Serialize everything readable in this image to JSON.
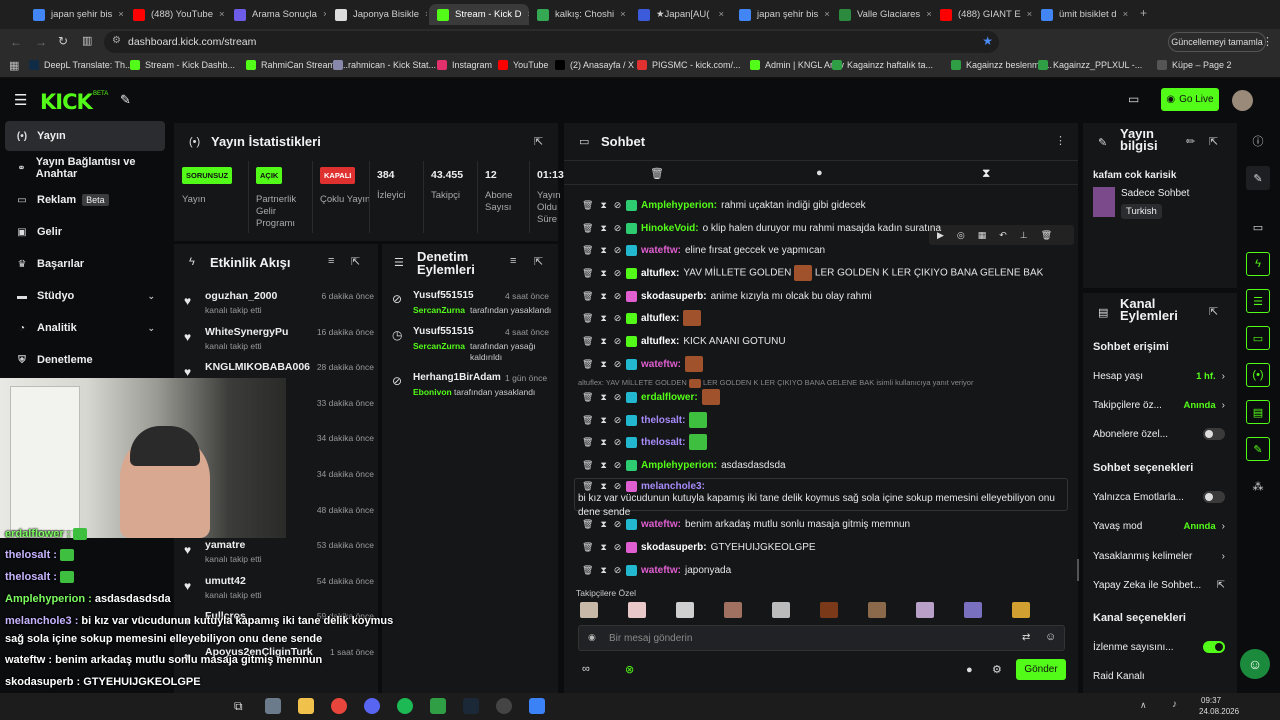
{
  "browser": {
    "tabs": [
      {
        "label": "japan şehir bis",
        "color": "#4285f4"
      },
      {
        "label": "(488) YouTube",
        "color": "#ff0000"
      },
      {
        "label": "Arama Sonuçla",
        "color": "#6c5ce7"
      },
      {
        "label": "Japonya Bisikle",
        "color": "#ddd"
      },
      {
        "label": "Stream - Kick D",
        "color": "#53fc18"
      },
      {
        "label": "kalkış: Choshi",
        "color": "#34a853"
      },
      {
        "label": "★Japan[AU(",
        "color": "#3b5bdb"
      },
      {
        "label": "japan şehir bis",
        "color": "#4285f4"
      },
      {
        "label": "Valle Glaciares",
        "color": "#2b8a3e"
      },
      {
        "label": "(488) GIANT E",
        "color": "#ff0000"
      },
      {
        "label": "ümit bisiklet d",
        "color": "#4285f4"
      }
    ],
    "url": "dashboard.kick.com/stream",
    "update_label": "Güncellemeyi tamamla",
    "bookmarks": [
      {
        "label": "DeepL Translate: Th...",
        "color": "#0f2b46"
      },
      {
        "label": "Stream - Kick Dashb...",
        "color": "#53fc18"
      },
      {
        "label": "RahmiCan Stream -...",
        "color": "#53fc18"
      },
      {
        "label": "rahmican - Kick Stat...",
        "color": "#8888aa"
      },
      {
        "label": "Instagram",
        "color": "#e1306c"
      },
      {
        "label": "YouTube",
        "color": "#ff0000"
      },
      {
        "label": "(2) Anasayfa / X",
        "color": "#000000"
      },
      {
        "label": "PIGSMC - kick.com/...",
        "color": "#e03131"
      },
      {
        "label": "Admin | KNGL Arşiv",
        "color": "#53fc18"
      },
      {
        "label": "Kagainzz haftalık ta...",
        "color": "#2f9e44"
      },
      {
        "label": "Kagainzz beslenme...",
        "color": "#2f9e44"
      },
      {
        "label": "Kagainzz_PPLXUL -...",
        "color": "#2f9e44"
      },
      {
        "label": "Küpe – Page 2",
        "color": "#555555"
      }
    ]
  },
  "nav": {
    "logo": "KICK",
    "logo_sup": "BETA",
    "go_live": "Go Live"
  },
  "sidebar": [
    {
      "label": "Yayın",
      "icon": "broadcast-icon"
    },
    {
      "label": "Yayın Bağlantısı ve Anahtar",
      "icon": "link-icon"
    },
    {
      "label": "Reklam",
      "icon": "ad-icon",
      "badge": "Beta"
    },
    {
      "label": "Gelir",
      "icon": "wallet-icon"
    },
    {
      "label": "Başarılar",
      "icon": "trophy-icon"
    },
    {
      "label": "Stüdyo",
      "icon": "studio-icon"
    },
    {
      "label": "Analitik",
      "icon": "chart-icon"
    },
    {
      "label": "Denetleme",
      "icon": "shield-icon"
    }
  ],
  "stats": {
    "title": "Yayın İstatistikleri",
    "items": [
      {
        "badge": "SORUNSUZ",
        "label": "Yayın",
        "color": "#53fc18"
      },
      {
        "badge": "AÇIK",
        "label": "Partnerlik Gelir Programı",
        "color": "#53fc18"
      },
      {
        "badge": "KAPALI",
        "label": "Çoklu Yayın",
        "color": "#e03131"
      },
      {
        "value": "384",
        "label": "İzleyici"
      },
      {
        "value": "43.455",
        "label": "Takipçi"
      },
      {
        "value": "12",
        "label": "Abone Sayısı"
      },
      {
        "value": "01:13",
        "label": "Yayın Oldu Süre"
      }
    ]
  },
  "events": {
    "title": "Etkinlik Akışı",
    "items": [
      {
        "name": "oguzhan_2000",
        "sub": "kanalı takip etti",
        "time": "6 dakika önce"
      },
      {
        "name": "WhiteSynergyPu",
        "sub": "kanalı takip etti",
        "time": "16 dakika önce"
      },
      {
        "name": "KNGLMIKOBABA006",
        "sub": "",
        "time": "28 dakika önce"
      },
      {
        "name": "",
        "sub": "",
        "time": "33 dakika önce"
      },
      {
        "name": "",
        "sub": "",
        "time": "34 dakika önce"
      },
      {
        "name": "",
        "sub": "",
        "time": "34 dakika önce"
      },
      {
        "name": "",
        "sub": "",
        "time": "48 dakika önce"
      },
      {
        "name": "yamatre",
        "sub": "kanalı takip etti",
        "time": "53 dakika önce"
      },
      {
        "name": "umutt42",
        "sub": "kanalı takip etti",
        "time": "54 dakika önce"
      },
      {
        "name": "Fullcros",
        "sub": "",
        "time": "59 dakika önce"
      },
      {
        "name": "Apoyus2enCliginTurk",
        "sub": "",
        "time": "1 saat önce"
      }
    ]
  },
  "mod": {
    "title": "Denetim Eylemleri",
    "items": [
      {
        "name": "Yusuf551515",
        "by": "SercanZurna",
        "action": "tarafından yasaklandı",
        "time": "4 saat önce"
      },
      {
        "name": "Yusuf551515",
        "by": "SercanZurna",
        "action": "tarafından yasağı kaldırıldı",
        "time": "4 saat önce"
      },
      {
        "name": "Herhang1BirAdam",
        "by": "Ebonivon",
        "action": "tarafından yasaklandı",
        "time": "1 gün önce"
      }
    ]
  },
  "chat": {
    "title": "Sohbet",
    "messages": [
      {
        "user": "Amplehyperion",
        "color": "#53fc18",
        "badge": "#2ecc71",
        "text": "rahmi uçaktan indiği gibi gidecek"
      },
      {
        "user": "HinokeVoid",
        "color": "#53fc18",
        "badge": "#2ecc71",
        "text": "o klip halen duruyor mu rahmi masajda kadın suratına"
      },
      {
        "user": "wateftw",
        "color": "#e05fd0",
        "badge": "#22b8cf",
        "text": "eline fırsat geccek ve yapmıcan"
      },
      {
        "user": "altuflex",
        "color": "#ffffff",
        "badge": "#53fc18",
        "text": "YAV MİLLETE GOLDEN [emote] LER GOLDEN K LER ÇIKIYO BANA GELENE BAK"
      },
      {
        "user": "skodasuperb",
        "color": "#ffffff",
        "badge": "#e05fd0",
        "text": "anime kızıyla mı olcak bu olay rahmi"
      },
      {
        "user": "altuflex",
        "color": "#ffffff",
        "badge": "#53fc18",
        "text": "[emote]"
      },
      {
        "user": "altuflex",
        "color": "#ffffff",
        "badge": "#53fc18",
        "text": "KICK ANANI GOTUNU"
      },
      {
        "user": "wateftw",
        "color": "#e05fd0",
        "badge": "#22b8cf",
        "text": "[emote]"
      },
      {
        "user": "erdalflower",
        "color": "#53fc18",
        "badge": "#22b8cf",
        "text": "[emote]",
        "reply": "altuflex: YAV MİLLETE GOLDEN [emote] LER GOLDEN K LER ÇIKIYO BANA GELENE BAK isimli kullanıcıya yanıt veriyor"
      },
      {
        "user": "thelosalt",
        "color": "#a78bfa",
        "badge": "#22b8cf",
        "text": "[emote]"
      },
      {
        "user": "thelosalt",
        "color": "#a78bfa",
        "badge": "#22b8cf",
        "text": "[emote]"
      },
      {
        "user": "Amplehyperion",
        "color": "#53fc18",
        "badge": "#2ecc71",
        "text": "asdasdasdsda"
      },
      {
        "user": "melanchole3",
        "color": "#a78bfa",
        "badge": "#e05fd0",
        "text": "bi kız var vücudunun kutuyla kapamış iki tane delik koymus sağ sola içine sokup memesini elleyebiliyon onu dene sende"
      },
      {
        "user": "wateftw",
        "color": "#e05fd0",
        "badge": "#22b8cf",
        "text": "benim arkadaş mutlu sonlu masaja gitmiş memnun"
      },
      {
        "user": "skodasuperb",
        "color": "#ffffff",
        "badge": "#e05fd0",
        "text": "GTYEHUIJGKEOLGPE"
      },
      {
        "user": "wateftw",
        "color": "#e05fd0",
        "badge": "#22b8cf",
        "text": "japonyada"
      }
    ],
    "follower_label": "Takipçilere Özel",
    "placeholder": "Bir mesaj gönderin",
    "send": "Gönder"
  },
  "info": {
    "title": "Yayın bilgisi",
    "stream_title": "kafam cok karisik",
    "category": "Sadece Sohbet",
    "language": "Turkish"
  },
  "channel": {
    "title": "Kanal Eylemleri",
    "sec1": "Sohbet erişimi",
    "items1": [
      {
        "label": "Hesap yaşı",
        "val": "1 hf."
      },
      {
        "label": "Takipçilere öz...",
        "val": "Anında"
      },
      {
        "label": "Abonelere özel...",
        "toggle": false
      }
    ],
    "sec2": "Sohbet seçenekleri",
    "items2": [
      {
        "label": "Yalnızca Emotlarla...",
        "toggle": false
      },
      {
        "label": "Yavaş mod",
        "val": "Anında"
      },
      {
        "label": "Yasaklanmış kelimeler",
        "val": ""
      },
      {
        "label": "Yapay Zeka ile Sohbet...",
        "val": ""
      }
    ],
    "sec3": "Kanal seçenekleri",
    "items3": [
      {
        "label": "İzlenme sayısını...",
        "toggle": true
      },
      {
        "label": "Raid Kanalı",
        "val": ""
      }
    ]
  },
  "overlay": [
    {
      "user": "erdalflower",
      "text": ""
    },
    {
      "user": "thelosalt",
      "text": ""
    },
    {
      "user": "thelosalt",
      "text": ""
    },
    {
      "user": "Amplehyperion",
      "text": "asdasdasdsda"
    },
    {
      "user": "melanchole3",
      "text": "bi kız var vücudunun kutuyla kapamış iki tane delik koymus"
    },
    {
      "user": "",
      "text": "sağ sola içine sokup memesini elleyebiliyon onu dene sende"
    },
    {
      "user": "wateftw",
      "text": "benim arkadaş mutlu sonlu masaja gitmiş memnun"
    },
    {
      "user": "skodasuperb",
      "text": "GTYEHUIJGKEOLGPE"
    },
    {
      "user": "wateftw",
      "text": "japonyada"
    }
  ],
  "taskbar": {
    "time": "09:37",
    "date": "24.08.2026"
  }
}
